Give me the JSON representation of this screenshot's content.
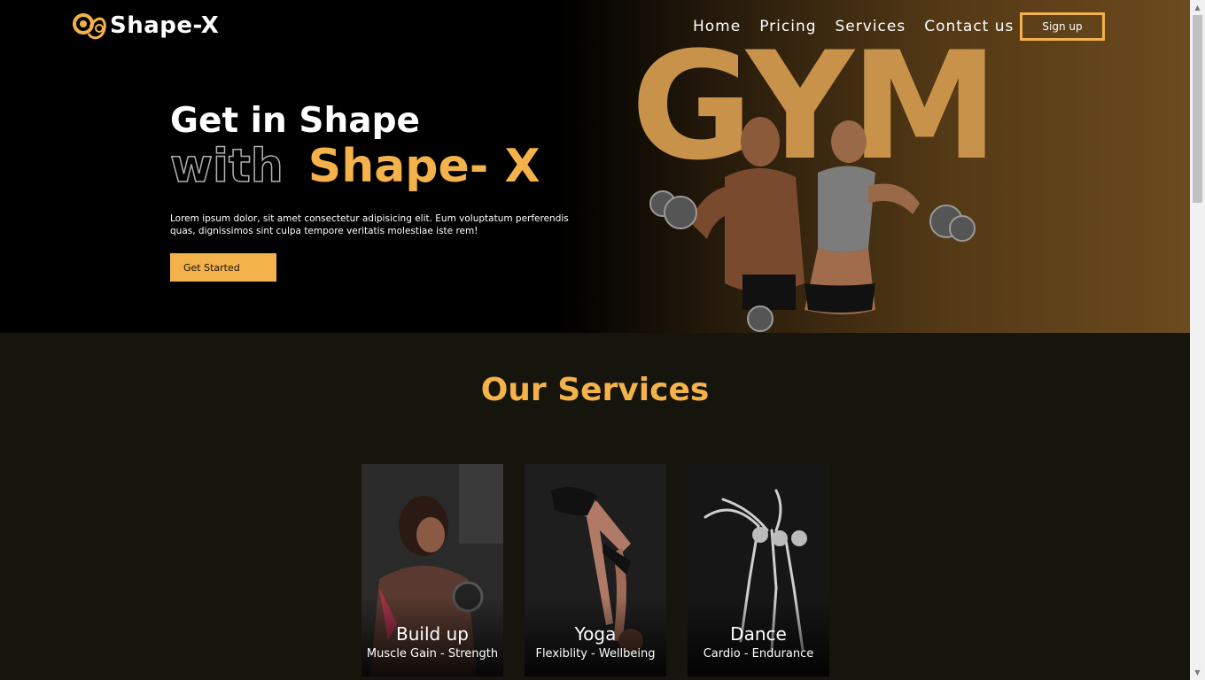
{
  "brand": {
    "name": "Shape-X",
    "accent": "#f4b24b"
  },
  "nav": [
    {
      "label": "Home"
    },
    {
      "label": "Pricing"
    },
    {
      "label": "Services"
    },
    {
      "label": "Contact us"
    }
  ],
  "signup_label": "Sign up",
  "hero": {
    "bg_word": "GYM",
    "title_line1": "Get in Shape",
    "title_with": "with",
    "title_brand": "Shape- X",
    "description": "Lorem ipsum dolor, sit amet consectetur adipisicing elit. Eum voluptatum perferendis quas, dignissimos sint culpa tempore veritatis molestiae iste rem!",
    "cta_label": "Get Started"
  },
  "services": {
    "title": "Our Services",
    "cards": [
      {
        "title": "Build up",
        "subtitle": "Muscle Gain - Strength"
      },
      {
        "title": "Yoga",
        "subtitle": "Flexiblity - Wellbeing"
      },
      {
        "title": "Dance",
        "subtitle": "Cardio - Endurance"
      }
    ]
  }
}
